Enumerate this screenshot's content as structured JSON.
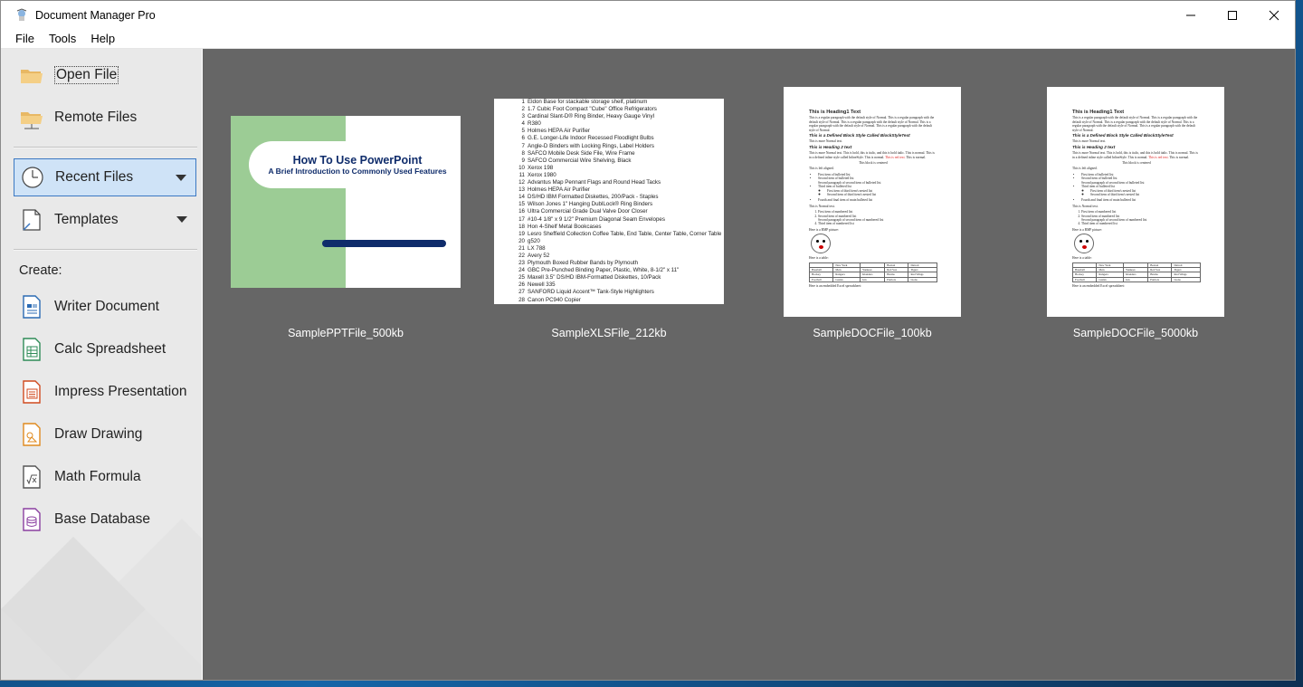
{
  "window": {
    "title": "Document Manager Pro"
  },
  "menu": [
    {
      "label": "File"
    },
    {
      "label": "Tools"
    },
    {
      "label": "Help"
    }
  ],
  "sidebar": {
    "open_file": "Open File",
    "remote_files": "Remote Files",
    "recent_files": "Recent Files",
    "templates": "Templates",
    "create_label": "Create:",
    "create_items": [
      {
        "label": "Writer Document",
        "icon": "writer-document-icon",
        "color": "#2a6ab3"
      },
      {
        "label": "Calc Spreadsheet",
        "icon": "calc-spreadsheet-icon",
        "color": "#2e8b57"
      },
      {
        "label": "Impress Presentation",
        "icon": "impress-presentation-icon",
        "color": "#d04a1f"
      },
      {
        "label": "Draw Drawing",
        "icon": "draw-drawing-icon",
        "color": "#e08a1e"
      },
      {
        "label": "Math Formula",
        "icon": "math-formula-icon",
        "color": "#555555"
      },
      {
        "label": "Base Database",
        "icon": "base-database-icon",
        "color": "#8a3fa0"
      }
    ]
  },
  "files": [
    {
      "name": "SamplePPTFile_500kb",
      "type": "ppt",
      "slide_title": "How To Use PowerPoint",
      "slide_subtitle": "A Brief Introduction to Commonly Used Features"
    },
    {
      "name": "SampleXLSFile_212kb",
      "type": "xls",
      "rows": [
        "Eldon Base for stackable storage shelf, platinum",
        "1.7 Cubic Foot Compact \"Cube\" Office Refrigerators",
        "Cardinal Slant-D® Ring Binder, Heavy Gauge Vinyl",
        "R380",
        "Holmes HEPA Air Purifier",
        "G.E. Longer-Life Indoor Recessed Floodlight Bulbs",
        "Angle-D Binders with Locking Rings, Label Holders",
        "SAFCO Mobile Desk Side File, Wire Frame",
        "SAFCO Commercial Wire Shelving, Black",
        "Xerox 198",
        "Xerox 1980",
        "Advantus Map Pennant Flags and Round Head Tacks",
        "Holmes HEPA Air Purifier",
        "DS/HD IBM Formatted Diskettes, 200/Pack - Staples",
        "Wilson Jones 1\" Hanging DublLock® Ring Binders",
        "Ultra Commercial Grade Dual Valve Door Closer",
        "#10-4 1/8\" x 9 1/2\" Premium Diagonal Seam Envelopes",
        "Hon 4-Shelf Metal Bookcases",
        "Lesro Sheffield Collection Coffee Table, End Table, Center Table, Corner Table",
        "g520",
        "LX 788",
        "Avery 52",
        "Plymouth Boxed Rubber Bands by Plymouth",
        "GBC Pre-Punched Binding Paper, Plastic, White, 8-1/2\" x 11\"",
        "Maxell 3.5\" DS/HD IBM-Formatted Diskettes, 10/Pack",
        "Newell 335",
        "SANFORD Liquid Accent™ Tank-Style Highlighters",
        "Canon PC940 Copier"
      ]
    },
    {
      "name": "SampleDOCFile_100kb",
      "type": "doc"
    },
    {
      "name": "SampleDOCFile_5000kb",
      "type": "doc"
    }
  ],
  "doc_preview": {
    "heading1": "This is Heading1 Text",
    "para1": "This is a regular paragraph with the default style of Normal. This is a regular paragraph with the default style of Normal. This is a regular paragraph with the default style of Normal. This is a regular paragraph with the default style of Normal. This is a regular paragraph with the default style of Normal.",
    "defined_block": "This is a Defined Block Style Called BlockStyleText",
    "normal_more": "This is more Normal text.",
    "heading2": "This is Heading 2 text",
    "mixed": "This is more Normal text. This is bold, this is italic, and this is bold italic. This is normal. This is in a defined inline style called InlineStyle. This is normal.",
    "red_text": "This is red text.",
    "normal_after": "This is normal.",
    "centered": "This block is centered",
    "left_aligned": "This is left aligned.",
    "bullets": [
      "First item of bulleted list",
      "Second item of bulleted list",
      "Second paragraph of second item of bulleted list",
      "Third item of bulleted list"
    ],
    "sub_bullets": [
      "First item of third item's nested list",
      "Second item of third item's nested list"
    ],
    "bullet_last": "Fourth and final item of main bulleted list",
    "normal_text": "This is Normal text.",
    "numbered": [
      "First item of numbered list",
      "Second item of numbered list",
      "Second paragraph of second item of numbered list",
      "Third item of numbered list"
    ],
    "bmp_caption": "Here is a BMP picture:",
    "table_caption": "Here is a table:",
    "table": [
      [
        "",
        "New York",
        "Boston",
        "Detroit"
      ],
      [
        "Baseball",
        "Mets",
        "Yankees",
        "Red Sox",
        "Tigers"
      ],
      [
        "Hockey",
        "Rangers",
        "Islanders",
        "Bruins",
        "Red Wings"
      ],
      [
        "Football",
        "Giants",
        "Jets",
        "Patriots",
        "Lions"
      ]
    ],
    "excel_caption": "Here is an embedded Excel spreadsheet:"
  }
}
